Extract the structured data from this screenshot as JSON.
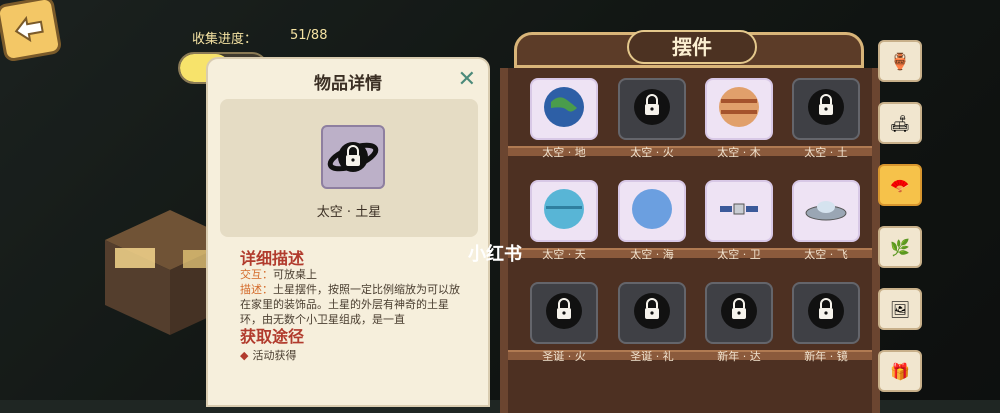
{
  "progress": {
    "label": "收集进度：",
    "count": "51/88",
    "fraction": 0.5795
  },
  "detail": {
    "title": "物品详情",
    "item_name": "太空 · 土星",
    "section_desc": "详细描述",
    "interact_key": "交互：",
    "interact_val": "可放桌上",
    "desc_key": "描述：",
    "desc_val": "土星摆件，按照一定比例缩放为可以放在家里的装饰品。土星的外层有神奇的土星环，由无数个小卫星组成，是一直",
    "section_obtain": "获取途径",
    "obtain_item": "活动获得"
  },
  "cabinet": {
    "title": "摆件",
    "items": [
      {
        "label": "太空 · 地",
        "locked": false,
        "icon": "earth-icon"
      },
      {
        "label": "太空 · 火",
        "locked": true,
        "icon": "lock-icon"
      },
      {
        "label": "太空 · 木",
        "locked": false,
        "icon": "jupiter-icon"
      },
      {
        "label": "太空 · 土",
        "locked": true,
        "icon": "lock-icon"
      },
      {
        "label": "太空 · 天",
        "locked": false,
        "icon": "uranus-icon"
      },
      {
        "label": "太空 · 海",
        "locked": false,
        "icon": "neptune-icon"
      },
      {
        "label": "太空 · 卫",
        "locked": false,
        "icon": "satellite-icon"
      },
      {
        "label": "太空 · 飞",
        "locked": false,
        "icon": "ufo-icon"
      },
      {
        "label": "圣诞 · 火",
        "locked": true,
        "icon": "lock-icon"
      },
      {
        "label": "圣诞 · 礼",
        "locked": true,
        "icon": "lock-icon"
      },
      {
        "label": "新年 · 达",
        "locked": true,
        "icon": "lock-icon"
      },
      {
        "label": "新年 · 镜",
        "locked": true,
        "icon": "lock-icon"
      }
    ]
  },
  "watermark": "小红书"
}
